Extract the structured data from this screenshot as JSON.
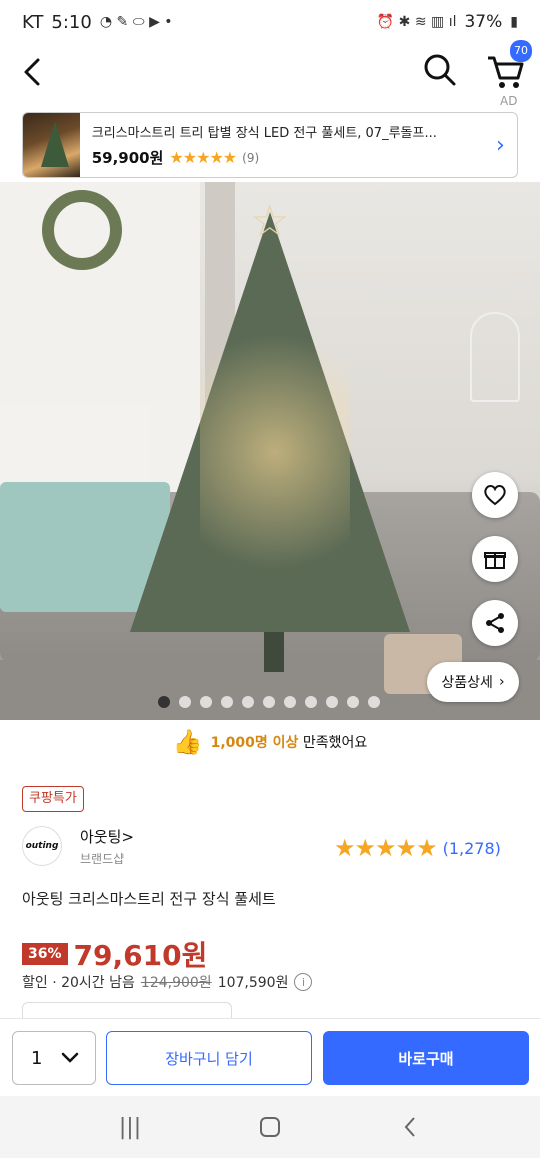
{
  "status_bar": {
    "carrier": "KT",
    "time": "5:10",
    "battery": "37%"
  },
  "header": {
    "cart_badge": "70"
  },
  "ad": {
    "label": "AD",
    "title": "크리스마스트리 트리 탑별 장식 LED 전구 풀세트, 07_루돌프...",
    "price": "59,900원",
    "rating_stars": "★★★★★",
    "review_count": "(9)"
  },
  "hero": {
    "detail_label": "상품상세",
    "dot_count": 11,
    "active_dot": 0
  },
  "satisfaction": {
    "count_text": "1,000명 이상",
    "suffix_text": " 만족했어요"
  },
  "product": {
    "badge": "쿠팡특가",
    "brand_logo_text": "outing",
    "brand_name": "아웃팅>",
    "brand_shop": "브랜드샵",
    "rating_stars": "★★★★★",
    "rating_count": "(1,278)",
    "title": "아웃팅 크리스마스트리 전구 장식 풀세트",
    "discount": "36%",
    "price": "79,610원",
    "discount_info": "할인 · 20시간 남음",
    "original_price": "124,900원",
    "member_price": "107,590원"
  },
  "bottom_bar": {
    "quantity": "1",
    "add_to_cart": "장바구니 담기",
    "buy_now": "바로구매"
  },
  "colors": {
    "accent": "#346aff",
    "price_red": "#c0392b",
    "star": "#f5a623"
  },
  "icons": {
    "back": "chevron-left-icon",
    "search": "search-icon",
    "cart": "cart-icon",
    "heart": "heart-icon",
    "gift": "gift-icon",
    "share": "share-icon",
    "thumb": "thumbs-up-icon",
    "info": "info-icon"
  }
}
